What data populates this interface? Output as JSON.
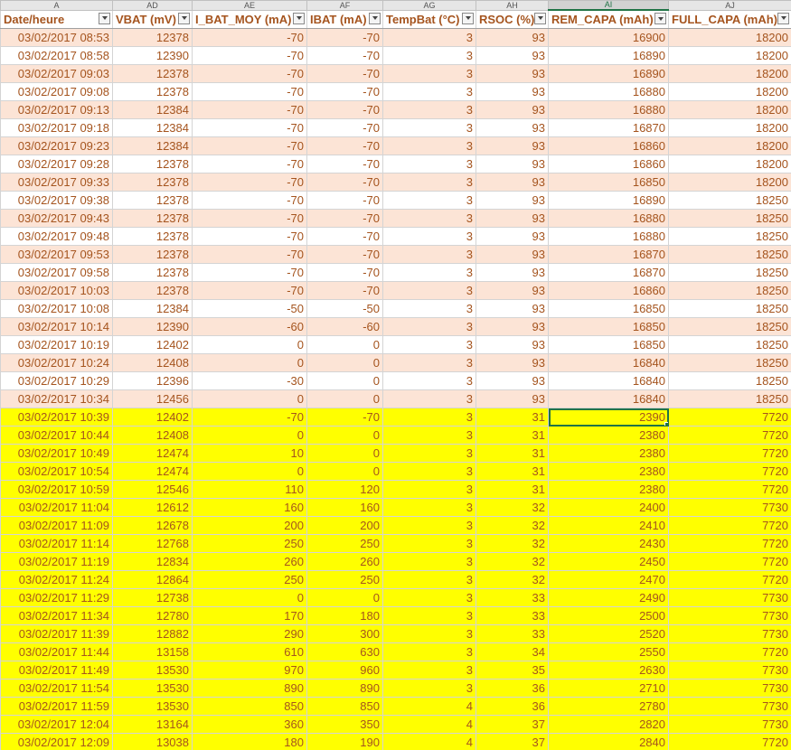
{
  "column_letters": [
    "A",
    "AD",
    "AE",
    "AF",
    "AG",
    "AH",
    "AI",
    "AJ"
  ],
  "headers": [
    "Date/heure",
    "VBAT (mV)",
    "I_BAT_MOY (mA)",
    "IBAT (mA)",
    "TempBat (°C)",
    "RSOC (%)",
    "REM_CAPA (mAh)",
    "FULL_CAPA (mAh)"
  ],
  "rows": [
    [
      "03/02/2017 08:53",
      "12378",
      "-70",
      "-70",
      "3",
      "93",
      "16900",
      "18200"
    ],
    [
      "03/02/2017 08:58",
      "12390",
      "-70",
      "-70",
      "3",
      "93",
      "16890",
      "18200"
    ],
    [
      "03/02/2017 09:03",
      "12378",
      "-70",
      "-70",
      "3",
      "93",
      "16890",
      "18200"
    ],
    [
      "03/02/2017 09:08",
      "12378",
      "-70",
      "-70",
      "3",
      "93",
      "16880",
      "18200"
    ],
    [
      "03/02/2017 09:13",
      "12384",
      "-70",
      "-70",
      "3",
      "93",
      "16880",
      "18200"
    ],
    [
      "03/02/2017 09:18",
      "12384",
      "-70",
      "-70",
      "3",
      "93",
      "16870",
      "18200"
    ],
    [
      "03/02/2017 09:23",
      "12384",
      "-70",
      "-70",
      "3",
      "93",
      "16860",
      "18200"
    ],
    [
      "03/02/2017 09:28",
      "12378",
      "-70",
      "-70",
      "3",
      "93",
      "16860",
      "18200"
    ],
    [
      "03/02/2017 09:33",
      "12378",
      "-70",
      "-70",
      "3",
      "93",
      "16850",
      "18200"
    ],
    [
      "03/02/2017 09:38",
      "12378",
      "-70",
      "-70",
      "3",
      "93",
      "16890",
      "18250"
    ],
    [
      "03/02/2017 09:43",
      "12378",
      "-70",
      "-70",
      "3",
      "93",
      "16880",
      "18250"
    ],
    [
      "03/02/2017 09:48",
      "12378",
      "-70",
      "-70",
      "3",
      "93",
      "16880",
      "18250"
    ],
    [
      "03/02/2017 09:53",
      "12378",
      "-70",
      "-70",
      "3",
      "93",
      "16870",
      "18250"
    ],
    [
      "03/02/2017 09:58",
      "12378",
      "-70",
      "-70",
      "3",
      "93",
      "16870",
      "18250"
    ],
    [
      "03/02/2017 10:03",
      "12378",
      "-70",
      "-70",
      "3",
      "93",
      "16860",
      "18250"
    ],
    [
      "03/02/2017 10:08",
      "12384",
      "-50",
      "-50",
      "3",
      "93",
      "16850",
      "18250"
    ],
    [
      "03/02/2017 10:14",
      "12390",
      "-60",
      "-60",
      "3",
      "93",
      "16850",
      "18250"
    ],
    [
      "03/02/2017 10:19",
      "12402",
      "0",
      "0",
      "3",
      "93",
      "16850",
      "18250"
    ],
    [
      "03/02/2017 10:24",
      "12408",
      "0",
      "0",
      "3",
      "93",
      "16840",
      "18250"
    ],
    [
      "03/02/2017 10:29",
      "12396",
      "-30",
      "0",
      "3",
      "93",
      "16840",
      "18250"
    ],
    [
      "03/02/2017 10:34",
      "12456",
      "0",
      "0",
      "3",
      "93",
      "16840",
      "18250"
    ],
    [
      "03/02/2017 10:39",
      "12402",
      "-70",
      "-70",
      "3",
      "31",
      "2390",
      "7720"
    ],
    [
      "03/02/2017 10:44",
      "12408",
      "0",
      "0",
      "3",
      "31",
      "2380",
      "7720"
    ],
    [
      "03/02/2017 10:49",
      "12474",
      "10",
      "0",
      "3",
      "31",
      "2380",
      "7720"
    ],
    [
      "03/02/2017 10:54",
      "12474",
      "0",
      "0",
      "3",
      "31",
      "2380",
      "7720"
    ],
    [
      "03/02/2017 10:59",
      "12546",
      "110",
      "120",
      "3",
      "31",
      "2380",
      "7720"
    ],
    [
      "03/02/2017 11:04",
      "12612",
      "160",
      "160",
      "3",
      "32",
      "2400",
      "7730"
    ],
    [
      "03/02/2017 11:09",
      "12678",
      "200",
      "200",
      "3",
      "32",
      "2410",
      "7720"
    ],
    [
      "03/02/2017 11:14",
      "12768",
      "250",
      "250",
      "3",
      "32",
      "2430",
      "7720"
    ],
    [
      "03/02/2017 11:19",
      "12834",
      "260",
      "260",
      "3",
      "32",
      "2450",
      "7720"
    ],
    [
      "03/02/2017 11:24",
      "12864",
      "250",
      "250",
      "3",
      "32",
      "2470",
      "7720"
    ],
    [
      "03/02/2017 11:29",
      "12738",
      "0",
      "0",
      "3",
      "33",
      "2490",
      "7730"
    ],
    [
      "03/02/2017 11:34",
      "12780",
      "170",
      "180",
      "3",
      "33",
      "2500",
      "7730"
    ],
    [
      "03/02/2017 11:39",
      "12882",
      "290",
      "300",
      "3",
      "33",
      "2520",
      "7730"
    ],
    [
      "03/02/2017 11:44",
      "13158",
      "610",
      "630",
      "3",
      "34",
      "2550",
      "7720"
    ],
    [
      "03/02/2017 11:49",
      "13530",
      "970",
      "960",
      "3",
      "35",
      "2630",
      "7730"
    ],
    [
      "03/02/2017 11:54",
      "13530",
      "890",
      "890",
      "3",
      "36",
      "2710",
      "7730"
    ],
    [
      "03/02/2017 11:59",
      "13530",
      "850",
      "850",
      "4",
      "36",
      "2780",
      "7730"
    ],
    [
      "03/02/2017 12:04",
      "13164",
      "360",
      "350",
      "4",
      "37",
      "2820",
      "7730"
    ],
    [
      "03/02/2017 12:09",
      "13038",
      "180",
      "190",
      "4",
      "37",
      "2840",
      "7720"
    ]
  ],
  "row_styles": [
    "pink",
    "white",
    "pink",
    "white",
    "pink",
    "white",
    "pink",
    "white",
    "pink",
    "white",
    "pink",
    "white",
    "pink",
    "white",
    "pink",
    "white",
    "pink",
    "white",
    "pink",
    "white",
    "pink",
    "yellow",
    "yellow",
    "yellow",
    "yellow",
    "yellow",
    "yellow",
    "yellow",
    "yellow",
    "yellow",
    "yellow",
    "yellow",
    "yellow",
    "yellow",
    "yellow",
    "yellow",
    "yellow",
    "yellow",
    "yellow",
    "yellow"
  ],
  "colors": {
    "pink": "#fce4d6",
    "yellow": "#ffff00",
    "text": "#a5541e",
    "selection": "#217346"
  }
}
